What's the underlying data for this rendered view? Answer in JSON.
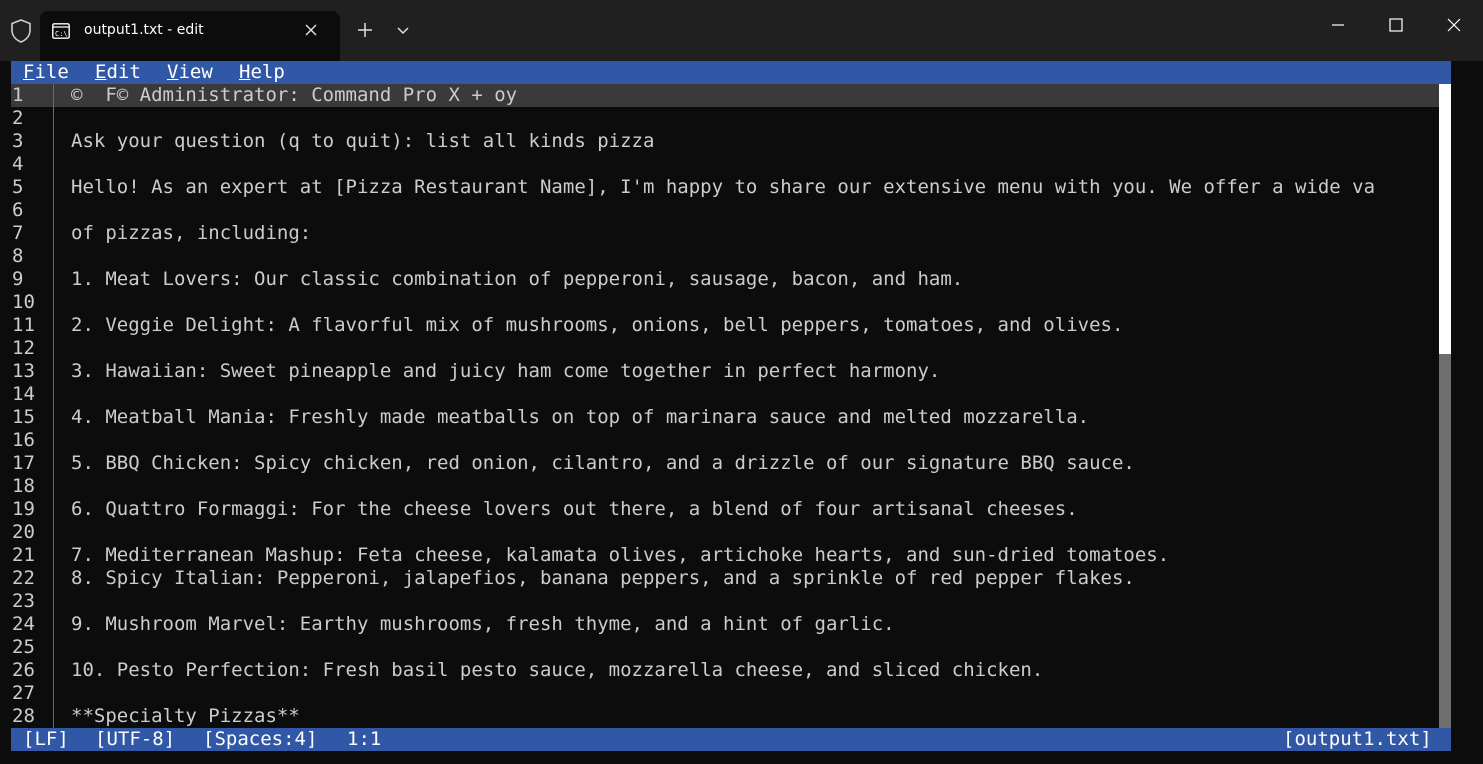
{
  "window": {
    "tab_title": "output1.txt - edit",
    "icons": {
      "shield": "shield-icon",
      "terminal": "terminal-icon",
      "close_tab": "close-icon",
      "new_tab": "plus-icon",
      "dropdown": "chevron-down-icon",
      "minimize": "minimize-icon",
      "maximize": "maximize-icon",
      "close_window": "close-window-icon"
    }
  },
  "colors": {
    "accent_bar": "#3158a6",
    "background": "#0c0c0c",
    "text": "#cccccc",
    "current_line": "#3a3a3a"
  },
  "menu": [
    {
      "mnemonic": "F",
      "rest": "ile"
    },
    {
      "mnemonic": "E",
      "rest": "dit"
    },
    {
      "mnemonic": "V",
      "rest": "iew"
    },
    {
      "mnemonic": "H",
      "rest": "elp"
    }
  ],
  "editor": {
    "current_line": 1,
    "lines": [
      {
        "num": "1",
        "text": "©  F© Administrator: Command Pro X + oy"
      },
      {
        "num": "2",
        "text": ""
      },
      {
        "num": "3",
        "text": "Ask your question (q to quit): list all kinds pizza"
      },
      {
        "num": "4",
        "text": ""
      },
      {
        "num": "5",
        "text": "Hello! As an expert at [Pizza Restaurant Name], I'm happy to share our extensive menu with you. We offer a wide va"
      },
      {
        "num": "6",
        "text": ""
      },
      {
        "num": "7",
        "text": "of pizzas, including:"
      },
      {
        "num": "8",
        "text": ""
      },
      {
        "num": "9",
        "text": "1. Meat Lovers: Our classic combination of pepperoni, sausage, bacon, and ham."
      },
      {
        "num": "10",
        "text": ""
      },
      {
        "num": "11",
        "text": "2. Veggie Delight: A flavorful mix of mushrooms, onions, bell peppers, tomatoes, and olives."
      },
      {
        "num": "12",
        "text": ""
      },
      {
        "num": "13",
        "text": "3. Hawaiian: Sweet pineapple and juicy ham come together in perfect harmony."
      },
      {
        "num": "14",
        "text": ""
      },
      {
        "num": "15",
        "text": "4. Meatball Mania: Freshly made meatballs on top of marinara sauce and melted mozzarella."
      },
      {
        "num": "16",
        "text": ""
      },
      {
        "num": "17",
        "text": "5. BBQ Chicken: Spicy chicken, red onion, cilantro, and a drizzle of our signature BBQ sauce."
      },
      {
        "num": "18",
        "text": ""
      },
      {
        "num": "19",
        "text": "6. Quattro Formaggi: For the cheese lovers out there, a blend of four artisanal cheeses."
      },
      {
        "num": "20",
        "text": ""
      },
      {
        "num": "21",
        "text": "7. Mediterranean Mashup: Feta cheese, kalamata olives, artichoke hearts, and sun-dried tomatoes."
      },
      {
        "num": "22",
        "text": "8. Spicy Italian: Pepperoni, jalapefios, banana peppers, and a sprinkle of red pepper flakes."
      },
      {
        "num": "23",
        "text": ""
      },
      {
        "num": "24",
        "text": "9. Mushroom Marvel: Earthy mushrooms, fresh thyme, and a hint of garlic."
      },
      {
        "num": "25",
        "text": ""
      },
      {
        "num": "26",
        "text": "10. Pesto Perfection: Fresh basil pesto sauce, mozzarella cheese, and sliced chicken."
      },
      {
        "num": "27",
        "text": ""
      },
      {
        "num": "28",
        "text": "**Specialty Pizzas**"
      }
    ],
    "scroll_fraction": 0.42
  },
  "status": {
    "line_ending": "[LF]",
    "encoding": "[UTF-8]",
    "indent": "[Spaces:4]",
    "cursor": "1:1",
    "filename": "[output1.txt]"
  }
}
